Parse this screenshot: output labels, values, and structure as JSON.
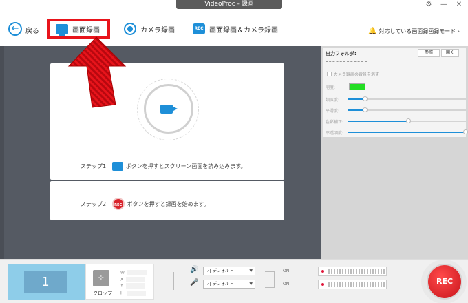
{
  "window": {
    "title": "VideoProc - 録画",
    "settings_icon": "gear-icon",
    "minimize": "—",
    "close": "✕"
  },
  "toolbar": {
    "back_label": "戻る",
    "tabs": [
      {
        "label": "画面録画",
        "icon": "monitor-icon",
        "active": true
      },
      {
        "label": "カメラ録画",
        "icon": "camera-icon"
      },
      {
        "label": "画面録画＆カメラ録画",
        "icon": "rec-icon"
      }
    ],
    "support_link": "対応している画面録画録モード ›",
    "highlight_color": "#e8141b"
  },
  "main": {
    "step1_num": "ステップ1.",
    "step1_text": "ボタンを押すとスクリーン画面を読み込みます。",
    "step2_num": "ステップ2.",
    "step2_text": "ボタンを押すと録画を始めます。",
    "step2_rec": "REC",
    "bg_color": "#555a63",
    "accent": "#1e8fd8"
  },
  "right_panel": {
    "output_folder_label": "出力フォルダ:",
    "browse_button": "参照",
    "open_button": "開く",
    "remove_bg_label": "カメラ録画の背景を消す",
    "rows": [
      {
        "label": "明度:",
        "type": "color",
        "color": "#22dd22"
      },
      {
        "label": "類似度:",
        "value": 0.15
      },
      {
        "label": "平滑度:",
        "value": 0.15
      },
      {
        "label": "色彩補正:",
        "value": 0.52
      },
      {
        "label": "不透明度:",
        "value": 1.0
      }
    ]
  },
  "bottom": {
    "screen_number": "1",
    "crop_label": "クロップ",
    "coord_labels": [
      "W",
      "X",
      "Y",
      "H"
    ],
    "audio": [
      {
        "device": "デフォルト",
        "state": "ON",
        "icon": "speaker-icon"
      },
      {
        "device": "デフォルト",
        "state": "ON",
        "icon": "microphone-icon"
      }
    ],
    "rec_label": "REC"
  }
}
